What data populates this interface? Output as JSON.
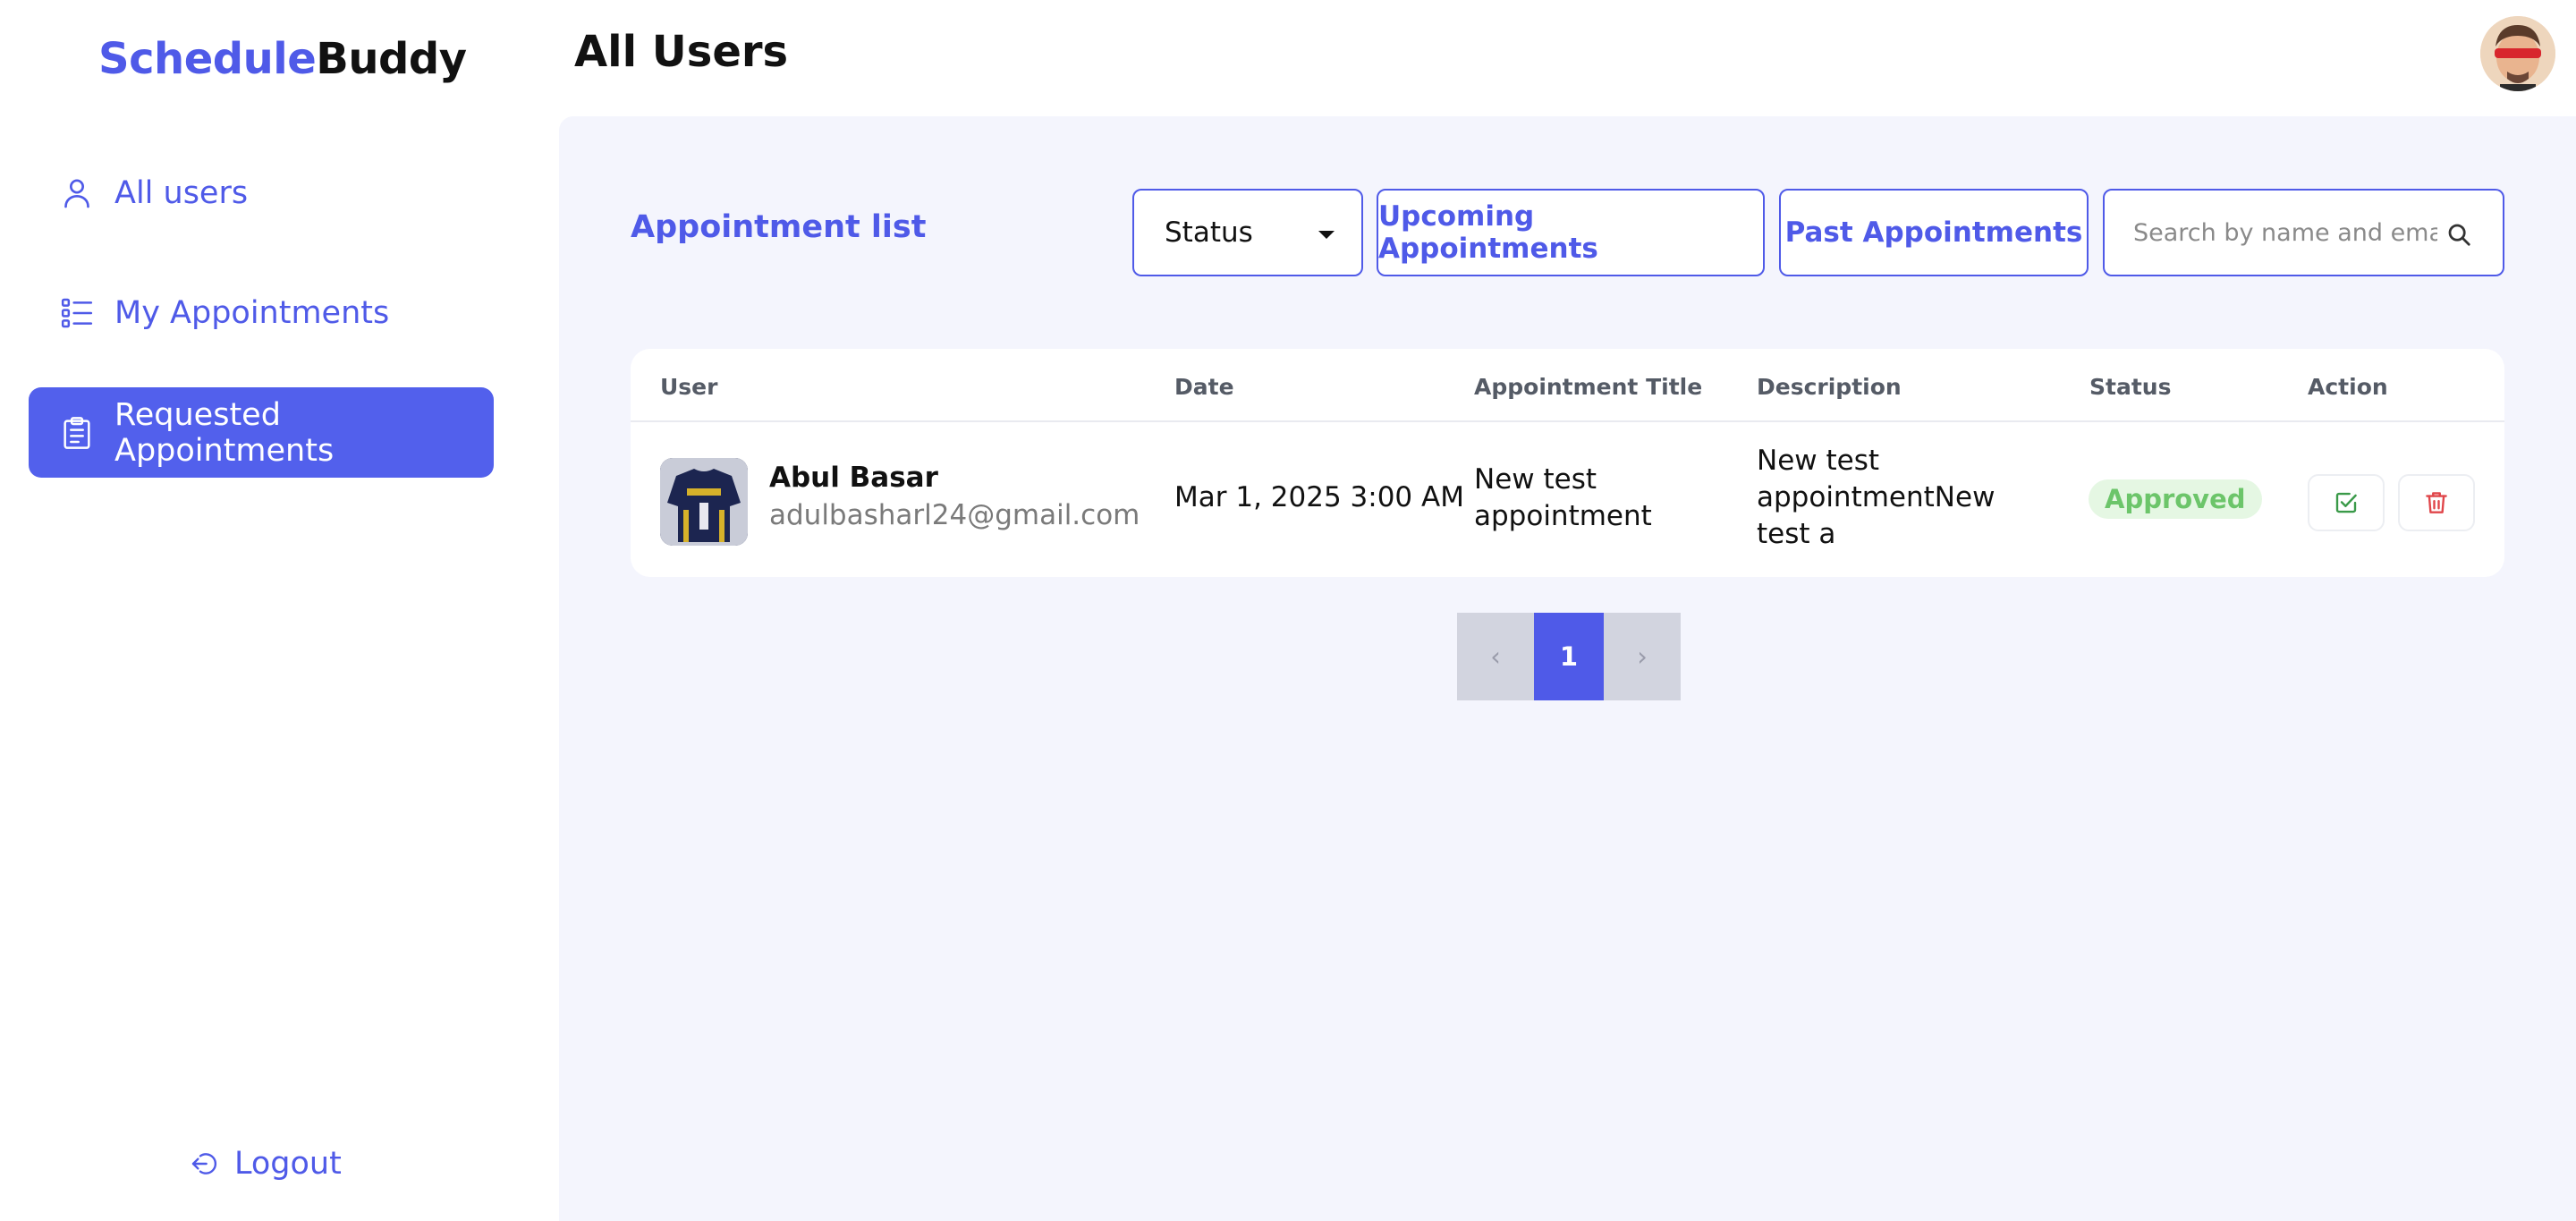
{
  "brand": {
    "part1": "Schedule",
    "part2": "Buddy"
  },
  "sidebar": {
    "items": [
      {
        "label": "All users",
        "icon": "user-icon",
        "active": false
      },
      {
        "label": "My Appointments",
        "icon": "list-icon",
        "active": false
      },
      {
        "label": "Requested Appointments",
        "icon": "clipboard-icon",
        "active": true
      }
    ],
    "logout_label": "Logout"
  },
  "header": {
    "title": "All Users",
    "avatar_icon": "avatar"
  },
  "main": {
    "list_title": "Appointment list",
    "status_select": {
      "value": "Status"
    },
    "filters": {
      "upcoming_label": "Upcoming Appointments",
      "past_label": "Past Appointments"
    },
    "search": {
      "placeholder": "Search by name and email",
      "value": ""
    }
  },
  "table": {
    "columns": [
      "User",
      "Date",
      "Appointment Title",
      "Description",
      "Status",
      "Action"
    ],
    "rows": [
      {
        "name": "Abul Basar",
        "email": "adulbasharl24@gmail.com",
        "date": "Mar 1, 2025 3:00 AM",
        "title_line1": "New test",
        "title_line2": "appointment",
        "desc_line1": "New test",
        "desc_line2": "appointmentNew",
        "desc_line3": "test a",
        "status": "Approved"
      }
    ]
  },
  "pagination": {
    "prev": "‹",
    "current": "1",
    "next": "›"
  },
  "colors": {
    "accent": "#4f5ae8",
    "active_nav": "#5260ec",
    "panel_bg": "#f4f5fd",
    "approved_text": "#6cc56a",
    "approved_bg": "#e5f7e3",
    "delete": "#e0464a"
  }
}
